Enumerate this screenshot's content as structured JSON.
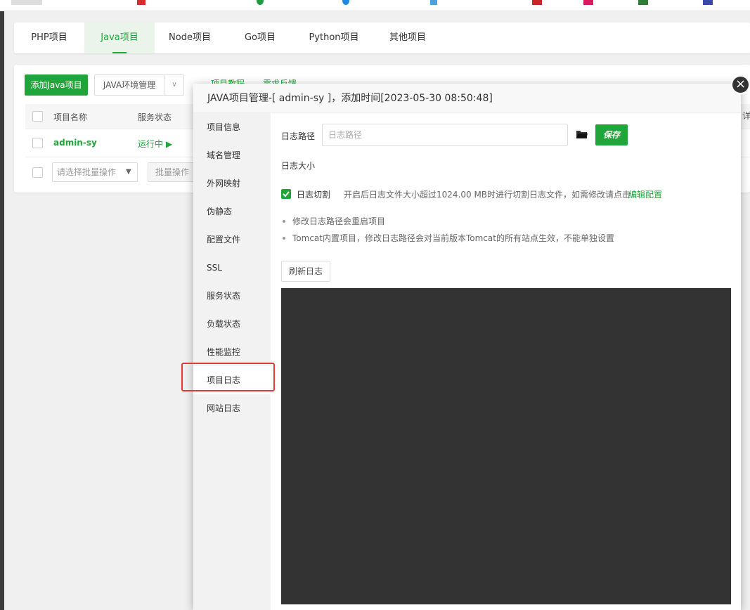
{
  "tabs": [
    {
      "label": "PHP项目"
    },
    {
      "label": "Java项目"
    },
    {
      "label": "Node项目"
    },
    {
      "label": "Go项目"
    },
    {
      "label": "Python项目"
    },
    {
      "label": "其他项目"
    }
  ],
  "toolbar": {
    "add_label": "添加Java项目",
    "env_label": "JAVA环境管理",
    "project_tutorial": "项目教程",
    "feedback": "需求反馈"
  },
  "table": {
    "headers": [
      "项目名称",
      "服务状态"
    ],
    "rows": [
      {
        "name": "admin-sy",
        "status": "运行中 ▶"
      }
    ],
    "batch_placeholder": "请选择批量操作",
    "batch_button": "批量操作",
    "detail": "详"
  },
  "modal": {
    "title": "JAVA项目管理-[ admin-sy ]，添加时间[2023-05-30 08:50:48]",
    "close": "×",
    "sidebar": [
      "项目信息",
      "域名管理",
      "外网映射",
      "伪静态",
      "配置文件",
      "SSL",
      "服务状态",
      "负载状态",
      "性能监控",
      "项目日志",
      "网站日志"
    ],
    "log_path_label": "日志路径",
    "log_path_placeholder": "日志路径",
    "save_label": "保存",
    "log_size_label": "日志大小",
    "log_cut_label": "日志切割",
    "log_cut_desc": "开启后日志文件大小超过1024.00 MB时进行切割日志文件，如需修改请点击",
    "log_cut_link": "编辑配置",
    "tips": [
      "修改日志路径会重启项目",
      "Tomcat内置项目，修改日志路径会对当前版本Tomcat的所有站点生效，不能单独设置"
    ],
    "refresh_label": "刷新日志"
  },
  "colors": {
    "accent": "#20a53a",
    "highlight_border": "#e53935",
    "log_background": "#333333"
  },
  "icons": [
    "folder-icon",
    "check-icon",
    "close-icon",
    "chevron-down-icon",
    "play-icon"
  ]
}
